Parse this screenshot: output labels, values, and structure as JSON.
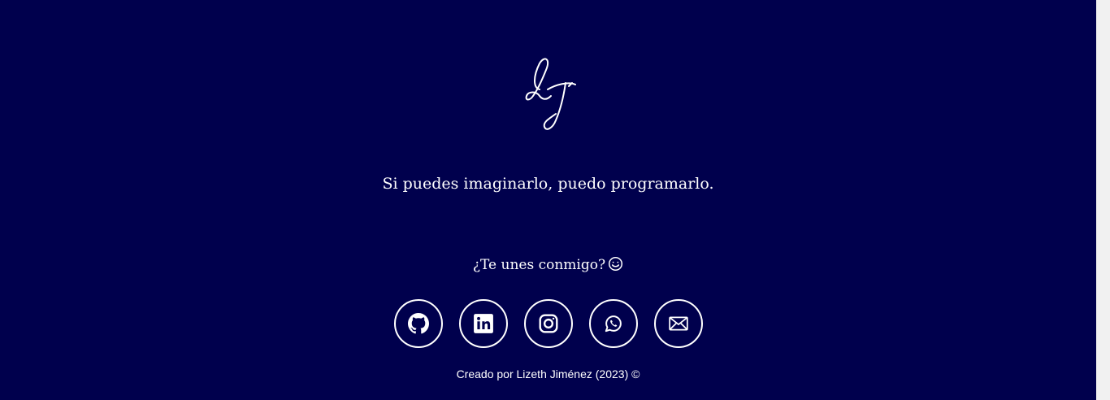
{
  "footer": {
    "logo_monogram": "LJ",
    "tagline": "Si puedes imaginarlo, puedo programarlo.",
    "join_text": "¿Te unes conmigo?",
    "join_icon": "smile-icon",
    "socials": [
      {
        "name": "github",
        "icon": "github-icon"
      },
      {
        "name": "linkedin",
        "icon": "linkedin-icon"
      },
      {
        "name": "instagram",
        "icon": "instagram-icon"
      },
      {
        "name": "whatsapp",
        "icon": "whatsapp-icon"
      },
      {
        "name": "email",
        "icon": "envelope-icon"
      }
    ],
    "credit": "Creado por Lizeth Jiménez (2023) ©"
  },
  "colors": {
    "background": "#00004d",
    "foreground": "#ffffff",
    "scrollbar_track": "#f1f1f1"
  }
}
